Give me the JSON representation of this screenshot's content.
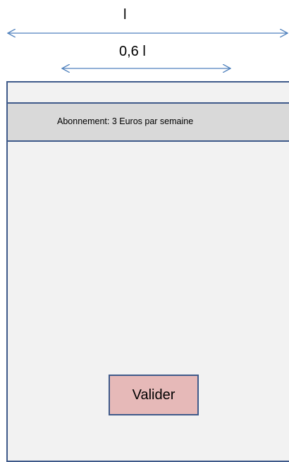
{
  "dimensions": {
    "full_width_label": "l",
    "partial_width_label": "0,6 l",
    "arrow_color": "#4f81bd"
  },
  "screen": {
    "subscription_text": "Abonnement: 3 Euros par semaine",
    "validate_label": "Valider",
    "frame_color": "#3f5a8a",
    "background_color": "#f2f2f2",
    "bar_color": "#d9d9d9",
    "button_color": "#e6b9b8"
  }
}
